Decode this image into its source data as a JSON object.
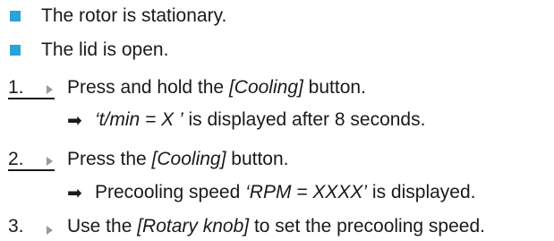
{
  "colors": {
    "bullet": "#2AA3D8",
    "text": "#1A1A1A",
    "step_arrow": "#9A9A9A"
  },
  "icons": {
    "bullet": "square-bullet-icon",
    "step_marker": "triangle-right-icon",
    "result": "heavy-right-arrow-icon"
  },
  "preconditions": [
    "The rotor is stationary.",
    "The lid is open."
  ],
  "steps": [
    {
      "number": "1.",
      "before": "Press and hold the ",
      "emphasis": "[Cooling]",
      "after": " button.",
      "result": {
        "arrow": "➡",
        "emphasis": "‘t/min = X ’",
        "after": " is displayed after 8 seconds."
      }
    },
    {
      "number": "2.",
      "before": "Press the ",
      "emphasis": "[Cooling]",
      "after": " button.",
      "result": {
        "arrow": "➡",
        "before": "Precooling speed ",
        "emphasis": "‘RPM = XXXX’",
        "after": " is displayed."
      }
    },
    {
      "number": "3.",
      "before": "Use the ",
      "emphasis": "[Rotary knob]",
      "after": " to set the precooling speed."
    }
  ]
}
